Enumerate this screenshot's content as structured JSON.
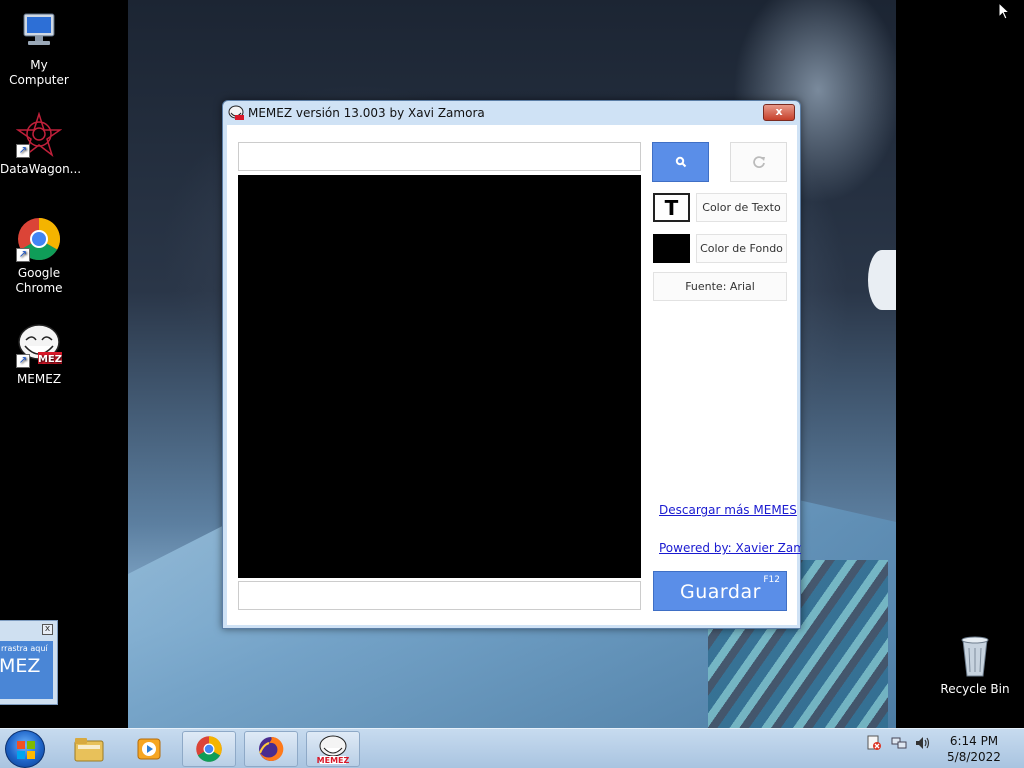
{
  "desktop": {
    "icons": [
      {
        "label": "My Computer"
      },
      {
        "label": "DataWagon..."
      },
      {
        "label": "Google\nChrome"
      },
      {
        "label": "MEMEZ"
      },
      {
        "label": "Recycle Bin"
      }
    ],
    "mini_widget": {
      "hint": "rrastra aquí",
      "logo": "MEZ",
      "close": "x"
    }
  },
  "window": {
    "title": "MEMEZ versión 13.003 by Xavi Zamora",
    "close_label": "x",
    "top_input": {
      "value": "",
      "placeholder": ""
    },
    "bottom_input": {
      "value": "",
      "placeholder": ""
    },
    "text_color_swatch": "T",
    "text_color_button": "Color de Texto",
    "bg_color_button": "Color de Fondo",
    "font_button": "Fuente: Arial",
    "download_link": "Descargar más MEMES",
    "powered_link": "Powered by: Xavier Zamora",
    "save_button": "Guardar",
    "save_shortcut": "F12",
    "colors": {
      "accent_blue": "#5a8ee8",
      "canvas": "#000000",
      "text_color": "#ffffff",
      "bg_color": "#000000"
    }
  },
  "taskbar": {
    "clock_time": "6:14 PM",
    "clock_date": "5/8/2022",
    "pinned": [
      "windows-explorer-icon",
      "media-player-icon",
      "chrome-icon",
      "firefox-icon",
      "memez-icon"
    ]
  }
}
